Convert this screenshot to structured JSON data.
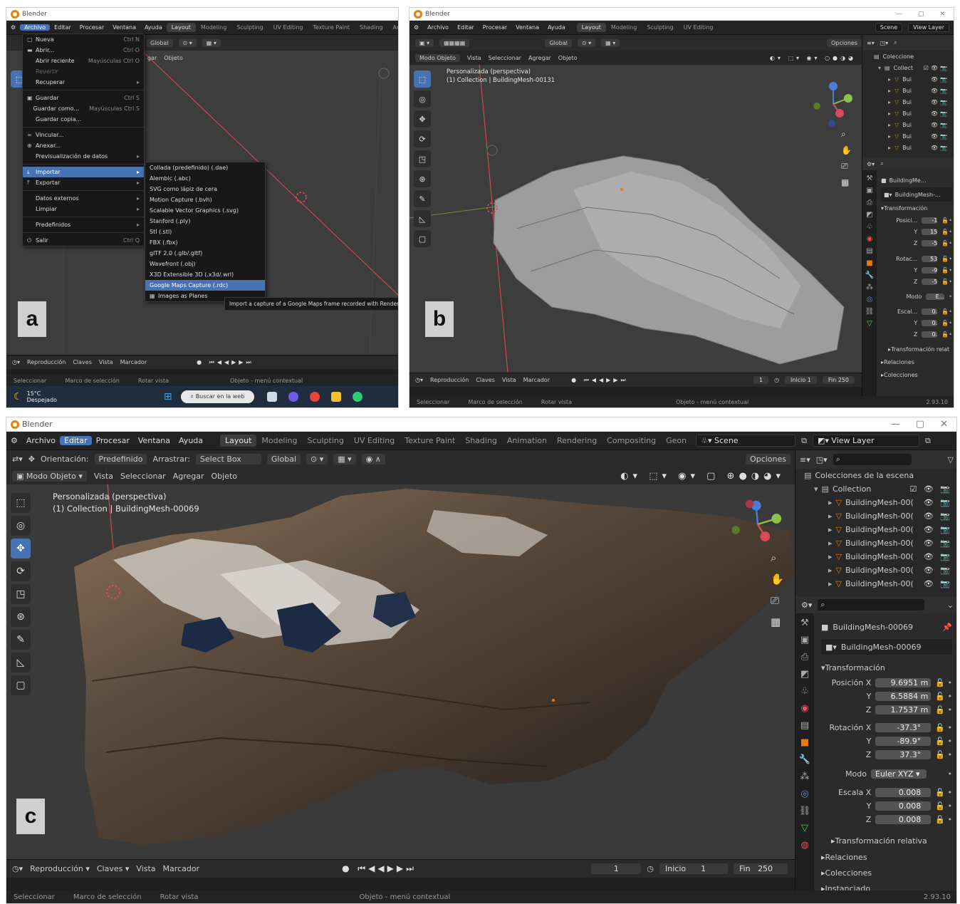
{
  "labels": {
    "a": "a",
    "b": "b",
    "c": "c"
  },
  "app_title": "Blender",
  "colors": {
    "accent": "#4772b3",
    "object_orange": "#e87d0d",
    "axis_x": "#d94b5a",
    "axis_y": "#8fc04a",
    "axis_z": "#4b7ed9"
  },
  "menubar": {
    "archivo": "Archivo",
    "editar": "Editar",
    "procesar": "Procesar",
    "ventana": "Ventana",
    "ayuda": "Ayuda",
    "workspaces": [
      "Layout",
      "Modeling",
      "Sculpting",
      "UV Editing",
      "Texture Paint",
      "Shading",
      "Animation",
      "Rendering",
      "Compositing",
      "Geon"
    ],
    "workspaces_a": [
      "Layout",
      "Modeling",
      "Sculpting",
      "UV Editing",
      "Texture Paint",
      "Shading",
      "Animat"
    ],
    "workspaces_b": [
      "Layout",
      "Modeling",
      "Sculpting",
      "UV Editing"
    ],
    "scene": "Scene",
    "view_layer": "View Layer"
  },
  "toolrow": {
    "orientacion": "Orientación:",
    "predefinido": "Predefinido",
    "arrastrar": "Arrastrar:",
    "select_box": "Select Box",
    "global": "Global",
    "opciones": "Opciones"
  },
  "header": {
    "modo_objeto": "Modo Objeto",
    "vista": "Vista",
    "seleccionar": "Seleccionar",
    "agregar": "Agregar",
    "objeto": "Objeto"
  },
  "viewport_b": {
    "line1": "Personalizada (perspectiva)",
    "line2": "(1) Collection | BuildingMesh-00131"
  },
  "viewport_c": {
    "line1": "Personalizada (perspectiva)",
    "line2": "(1) Collection | BuildingMesh-00069"
  },
  "timeline": {
    "reproduccion": "Reproducción",
    "claves": "Claves",
    "vista": "Vista",
    "marcador": "Marcador",
    "frame": "1",
    "inicio_label": "Inicio",
    "inicio": "1",
    "fin_label": "Fin",
    "fin": "250"
  },
  "statusbar": {
    "seleccionar": "Seleccionar",
    "marco": "Marco de selección",
    "rotar": "Rotar vista",
    "menu_contextual": "Objeto - menú contextual",
    "version": "2.93.10"
  },
  "outliner_c": {
    "title": "Colecciones de la escena",
    "collection": "Collection",
    "items": [
      "BuildingMesh-00(",
      "BuildingMesh-00(",
      "BuildingMesh-00(",
      "BuildingMesh-00(",
      "BuildingMesh-00(",
      "BuildingMesh-00(",
      "BuildingMesh-00("
    ]
  },
  "outliner_b": {
    "title": "Coleccione",
    "collection": "Collect",
    "items": [
      "Bui",
      "Bui",
      "Bui",
      "Bui",
      "Bui",
      "Bui",
      "Bui"
    ]
  },
  "properties_c": {
    "object_name": "BuildingMesh-00069",
    "data_name": "BuildingMesh-00069",
    "transform": "Transformación",
    "pos_label": "Posición X",
    "pos_x": "9.6951 m",
    "pos_y": "6.5884 m",
    "pos_z": "1.7537 m",
    "rot_label": "Rotación X",
    "rot_x": "-37.3°",
    "rot_y": "-89.9°",
    "rot_z": "37.3°",
    "modo_label": "Modo",
    "modo": "Euler XYZ",
    "esc_label": "Escala X",
    "esc_x": "0.008",
    "esc_y": "0.008",
    "esc_z": "0.008",
    "rel": "Transformación relativa",
    "relaciones": "Relaciones",
    "colecciones": "Colecciones",
    "instanciado": "Instanciado",
    "y": "Y",
    "z": "Z"
  },
  "properties_b": {
    "object_name": "BuildingMe...",
    "data_name": "BuildingMesh-...",
    "transform": "Transformación",
    "pos_label": "Posici...",
    "pos_x": "-1",
    "pos_y": "15",
    "pos_z": "-5",
    "rot_label": "Rotac...",
    "rot_x": "53",
    "rot_y": "-9",
    "rot_z": "-5",
    "modo_label": "Modo",
    "modo": "E...",
    "esc_label": "Escal...",
    "esc_x": "0.",
    "esc_y": "0.",
    "esc_z": "0.",
    "rel": "Transformación relat",
    "relaciones": "Relaciones",
    "colecciones": "Colecciones",
    "y": "Y",
    "z": "Z"
  },
  "file_menu": {
    "items": [
      {
        "label": "Nueva",
        "shortcut": "Ctrl N"
      },
      {
        "label": "Abrir...",
        "shortcut": "Ctrl O"
      },
      {
        "label": "Abrir reciente",
        "shortcut": "Mayúsculas Ctrl O"
      },
      {
        "label": "Revertir",
        "shortcut": ""
      },
      {
        "label": "Recuperar",
        "shortcut": ""
      },
      {
        "label": "Guardar",
        "shortcut": "Ctrl S"
      },
      {
        "label": "Guardar como...",
        "shortcut": "Mayúsculas Ctrl S"
      },
      {
        "label": "Guardar copia...",
        "shortcut": ""
      },
      {
        "label": "Vincular...",
        "shortcut": ""
      },
      {
        "label": "Anexar...",
        "shortcut": ""
      },
      {
        "label": "Previsualización de datos",
        "shortcut": ""
      },
      {
        "label": "Importar",
        "shortcut": ""
      },
      {
        "label": "Exportar",
        "shortcut": ""
      },
      {
        "label": "Datos externos",
        "shortcut": ""
      },
      {
        "label": "Limpiar",
        "shortcut": ""
      },
      {
        "label": "Predefinidos",
        "shortcut": ""
      },
      {
        "label": "Salir",
        "shortcut": "Ctrl Q"
      }
    ]
  },
  "import_menu": {
    "items": [
      "Collada (predefinido) (.dae)",
      "Alembic (.abc)",
      "SVG como lápiz de cera",
      "Motion Capture (.bvh)",
      "Scalable Vector Graphics (.svg)",
      "Stanford (.ply)",
      "Stl (.stl)",
      "FBX (.fbx)",
      "glTF 2.0 (.glb/.gltf)",
      "Wavefront (.obj)",
      "X3D Extensible 3D (.x3d/.wrl)",
      "Google Maps Capture (.rdc)",
      "Images as Planes"
    ],
    "tooltip": "Import a capture of a Google Maps frame recorded with RenderDoc"
  },
  "panel_a_header": {
    "agregar": "gar",
    "objeto": "Objeto"
  },
  "taskbar": {
    "temp": "15°C",
    "weather": "Despejado",
    "search": "Buscar en la web"
  }
}
